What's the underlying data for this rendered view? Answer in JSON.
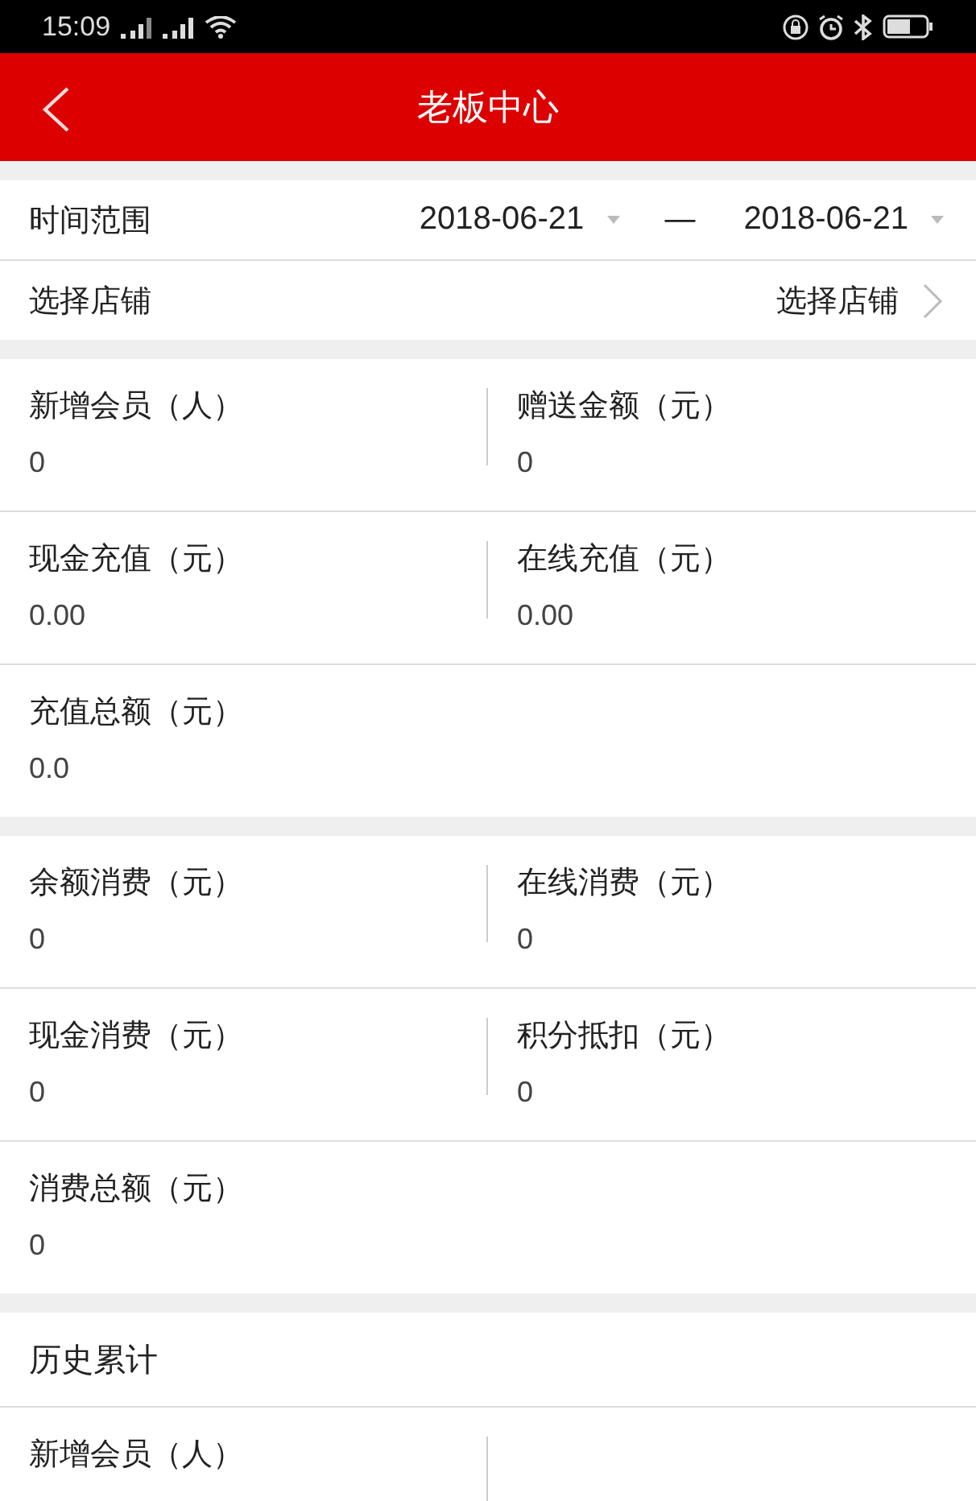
{
  "status_bar": {
    "time": "15:09"
  },
  "header": {
    "title": "老板中心"
  },
  "filters": {
    "date_range": {
      "label": "时间范围",
      "start": "2018-06-21",
      "separator": "—",
      "end": "2018-06-21"
    },
    "store": {
      "label": "选择店铺",
      "value": "选择店铺"
    }
  },
  "sections": [
    {
      "rows": [
        {
          "divided": true,
          "cells": [
            {
              "label": "新增会员（人）",
              "value": "0"
            },
            {
              "label": "赠送金额（元）",
              "value": "0"
            }
          ]
        },
        {
          "divided": true,
          "cells": [
            {
              "label": "现金充值（元）",
              "value": "0.00"
            },
            {
              "label": "在线充值（元）",
              "value": "0.00"
            }
          ]
        },
        {
          "divided": false,
          "cells": [
            {
              "label": "充值总额（元）",
              "value": "0.0"
            }
          ]
        }
      ]
    },
    {
      "rows": [
        {
          "divided": true,
          "cells": [
            {
              "label": "余额消费（元）",
              "value": "0"
            },
            {
              "label": "在线消费（元）",
              "value": "0"
            }
          ]
        },
        {
          "divided": true,
          "cells": [
            {
              "label": "现金消费（元）",
              "value": "0"
            },
            {
              "label": "积分抵扣（元）",
              "value": "0"
            }
          ]
        },
        {
          "divided": false,
          "cells": [
            {
              "label": "消费总额（元）",
              "value": "0"
            }
          ]
        }
      ]
    },
    {
      "title": "历史累计",
      "rows": [
        {
          "divided": true,
          "cells": [
            {
              "label": "新增会员（人）"
            }
          ]
        }
      ]
    }
  ]
}
